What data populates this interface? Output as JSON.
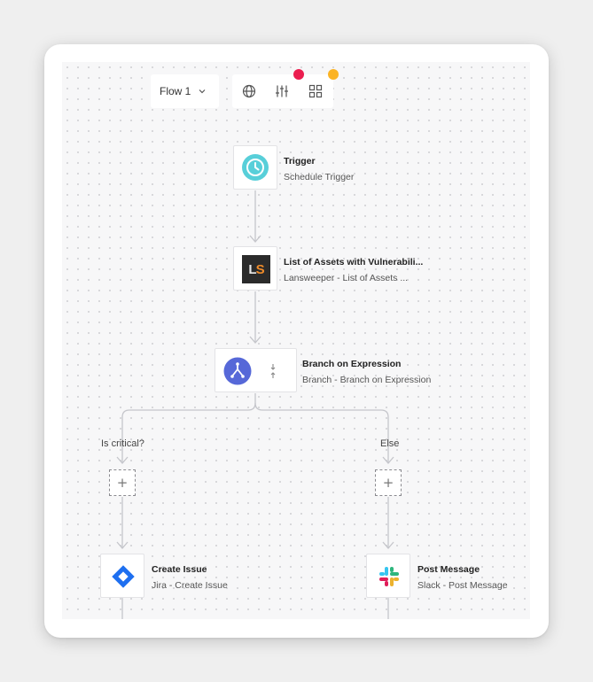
{
  "toolbar": {
    "flow_label": "Flow 1",
    "chevron_icon": "chevron-down-icon",
    "icons": [
      "globe-icon",
      "sliders-icon",
      "grid-icon"
    ]
  },
  "status_dots": {
    "red": "#eb1d4f",
    "orange": "#fbb324"
  },
  "nodes": {
    "trigger": {
      "title": "Trigger",
      "subtitle": "Schedule Trigger",
      "icon": "clock-icon",
      "color": "#58cfd9"
    },
    "assets": {
      "title": "List of Assets with Vulnerabili...",
      "subtitle": "Lansweeper - List of Assets ...",
      "icon": "lansweeper-logo",
      "logo_text": "LS"
    },
    "branch": {
      "title": "Branch on Expression",
      "subtitle": "Branch - Branch on Expression",
      "icon": "branch-icon",
      "color": "#5668d8"
    },
    "jira": {
      "title": "Create Issue",
      "subtitle": "Jira - Create Issue",
      "icon": "jira-logo",
      "color": "#1e6ff0"
    },
    "slack": {
      "title": "Post Message",
      "subtitle": "Slack - Post Message",
      "icon": "slack-logo"
    }
  },
  "branches": {
    "left": "Is critical?",
    "right": "Else",
    "add_symbol": "+"
  }
}
